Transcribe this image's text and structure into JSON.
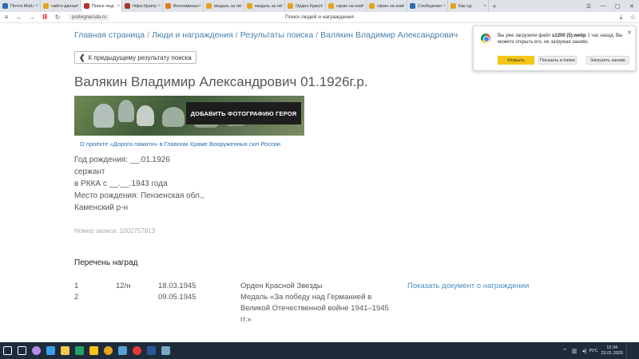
{
  "browser": {
    "tabs": [
      {
        "label": "Почта Mail.r",
        "color": "#2d6db3",
        "active": false
      },
      {
        "label": "найти данны",
        "color": "#e5a321",
        "active": false
      },
      {
        "label": "Поиск люд",
        "color": "#b4332c",
        "active": true
      },
      {
        "label": "https://pamy",
        "color": "#a83232",
        "active": false
      },
      {
        "label": "Воспоминан",
        "color": "#e07b1a",
        "active": false
      },
      {
        "label": "медаль за по",
        "color": "#e5a321",
        "active": false
      },
      {
        "label": "медаль за по",
        "color": "#e5a321",
        "active": false
      },
      {
        "label": "Орден Красн",
        "color": "#e5a321",
        "active": false
      },
      {
        "label": "скрин на ком",
        "color": "#e5a321",
        "active": false
      },
      {
        "label": "скрин на ком",
        "color": "#e5a321",
        "active": false
      },
      {
        "label": "Сообщения",
        "color": "#2d6db3",
        "active": false
      },
      {
        "label": "Как сд",
        "color": "#e5a321",
        "active": false
      }
    ],
    "url": "podvignaroda.ru",
    "page_title": "Поиск людей и награждения"
  },
  "breadcrumb": {
    "home": "Главная страница",
    "people": "Люди и награждения",
    "results": "Результаты поиска",
    "current": "Валякин Владимир Александрович",
    "sep": "/"
  },
  "back_button": "К предыдущему результату поиска",
  "person": {
    "title": "Валякин Владимир Александрович 01.1926г.р.",
    "birth_date": "Год рождения: __.01.1926",
    "rank": "сержант",
    "service": "в РККА с __.__.1943 года",
    "birthplace_line1": "Место рождения: Пензенская обл.,",
    "birthplace_line2": "Каменский р-н",
    "record_no": "Номер записи: 1002757813"
  },
  "banner": {
    "button": "ДОБАВИТЬ ФОТОГРАФИЮ ГЕРОЯ",
    "project_link": "О проекте «Дорога памяти» в Главном Храме Вооруженных сил России"
  },
  "awards": {
    "title": "Перечень наград",
    "rows": [
      {
        "num": "1",
        "code": "12/н",
        "date": "18.03.1945",
        "name": "Орден Красной Звезды",
        "doc": "Показать документ о награждении"
      },
      {
        "num": "2",
        "code": "",
        "date": "09.05.1945",
        "name": "Медаль «За победу над Германией в Великой Отечественной войне 1941–1945 гг.»",
        "doc": ""
      }
    ]
  },
  "download": {
    "msg_prefix": "Вы уже загрузили файл ",
    "file": "s1200 (5).webp",
    "msg_suffix": " 1 час назад. Вы можете открыть его, не загружая заново.",
    "open": "Открыть",
    "show_folder": "Показать в папке",
    "download_again": "Загрузить заново"
  },
  "taskbar": {
    "lang": "РУС",
    "time": "12:34",
    "date": "23.01.2020",
    "icons": [
      {
        "name": "start-icon",
        "color": "#ffffff"
      },
      {
        "name": "search-icon",
        "color": "#ffffff"
      },
      {
        "name": "cortana-icon",
        "color": "#b28be8"
      },
      {
        "name": "ie-icon",
        "color": "#3a9ee8"
      },
      {
        "name": "explorer-icon",
        "color": "#f3c94b"
      },
      {
        "name": "excel-icon",
        "color": "#21a366"
      },
      {
        "name": "yandex-icon",
        "color": "#f5c518"
      },
      {
        "name": "chrome-icon",
        "color": "#e5a321"
      },
      {
        "name": "paint-icon",
        "color": "#5aa0d6"
      },
      {
        "name": "yandex-browser-icon",
        "color": "#e53935"
      },
      {
        "name": "word-icon",
        "color": "#2b579a"
      },
      {
        "name": "viewer-icon",
        "color": "#7aa7c7"
      }
    ]
  }
}
